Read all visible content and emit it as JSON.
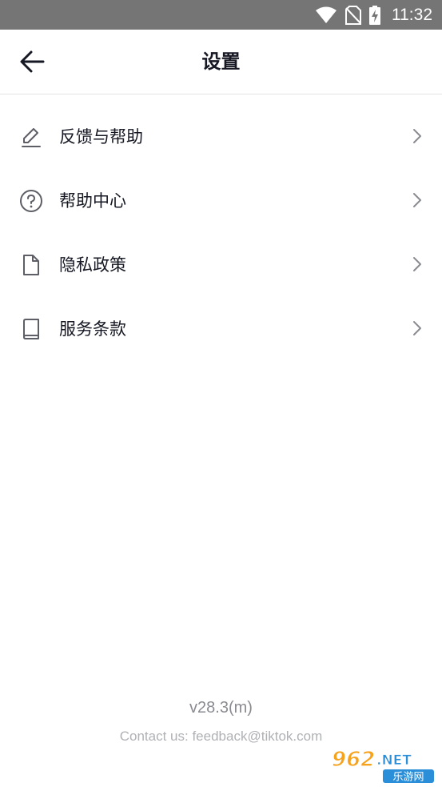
{
  "status_bar": {
    "time": "11:32",
    "icons": [
      "wifi-icon",
      "no-sim-icon",
      "battery-charging-icon"
    ]
  },
  "header": {
    "title": "设置",
    "back_icon": "back-arrow-icon"
  },
  "menu": {
    "items": [
      {
        "label": "反馈与帮助",
        "icon": "pencil-icon"
      },
      {
        "label": "帮助中心",
        "icon": "help-circle-icon"
      },
      {
        "label": "隐私政策",
        "icon": "document-icon"
      },
      {
        "label": "服务条款",
        "icon": "book-icon"
      }
    ],
    "chevron_icon": "chevron-right-icon"
  },
  "footer": {
    "version": "v28.3(m)",
    "contact": "Contact us: feedback@tiktok.com"
  },
  "watermark": {
    "logo_text": "962.NET",
    "caption": "乐游网",
    "colors": {
      "orange": "#f7a21b",
      "blue": "#2a8fd8"
    }
  },
  "colors": {
    "status_bar_bg": "#757575",
    "text_primary": "#161823",
    "divider": "#e3e3e4",
    "chevron": "#8a8b91"
  }
}
